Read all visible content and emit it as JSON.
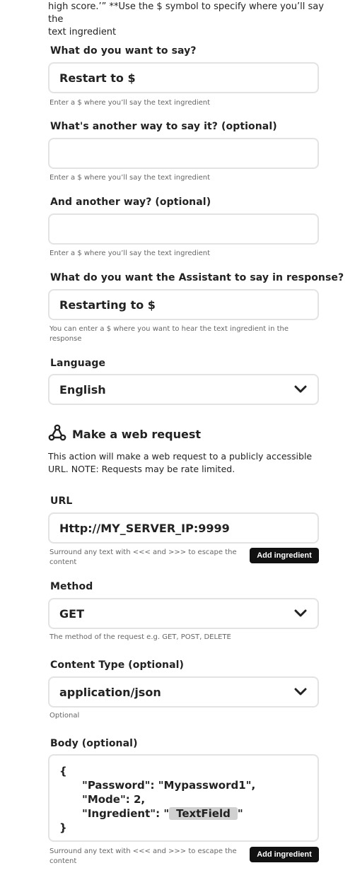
{
  "intro": {
    "line1": "high score.’” **Use the $ symbol to specify where you’ll say the",
    "line2": "text ingredient"
  },
  "phrase1": {
    "label": "What do you want to say?",
    "value": "Restart to $",
    "helper": "Enter a $ where you’ll say the text ingredient"
  },
  "phrase2": {
    "label": "What's another way to say it? (optional)",
    "value": "",
    "helper": "Enter a $ where you’ll say the text ingredient"
  },
  "phrase3": {
    "label": "And another way? (optional)",
    "value": "",
    "helper": "Enter a $ where you’ll say the text ingredient"
  },
  "response": {
    "label": "What do you want the Assistant to say in response?",
    "value": "Restarting to $",
    "helper_line1": "You can enter a $ where you want to hear the text ingredient in the",
    "helper_line2": "response"
  },
  "language": {
    "label": "Language",
    "selected": "English"
  },
  "webrequest": {
    "icon": "webhook-icon",
    "title": "Make a web request",
    "desc_line1": "This action will make a web request to a publicly accessible",
    "desc_line2": "URL. NOTE: Requests may be rate limited."
  },
  "url": {
    "label": "URL",
    "value": "Http://MY_SERVER_IP:9999",
    "helper_line1": "Surround any text with <<< and >>> to escape the",
    "helper_line2": "content",
    "add_button": "Add ingredient"
  },
  "method": {
    "label": "Method",
    "selected": "GET",
    "helper": "The method of the request e.g. GET, POST, DELETE"
  },
  "content_type": {
    "label": "Content Type (optional)",
    "selected": "application/json",
    "helper": "Optional"
  },
  "body": {
    "label": "Body (optional)",
    "open_brace": "{",
    "line_password": "\"Password\": \"Mypassword1\",",
    "line_mode": "\"Mode\": 2,",
    "line_ingredient_prefix": "\"Ingredient\": \"",
    "ingredient_pill": "TextField",
    "line_ingredient_suffix": "\"",
    "close_brace": "}",
    "helper_line1": "Surround any text with <<< and >>> to escape the",
    "helper_line2": "content",
    "add_button": "Add ingredient"
  },
  "icons": {
    "select_chevron": "chevron-down-icon"
  }
}
